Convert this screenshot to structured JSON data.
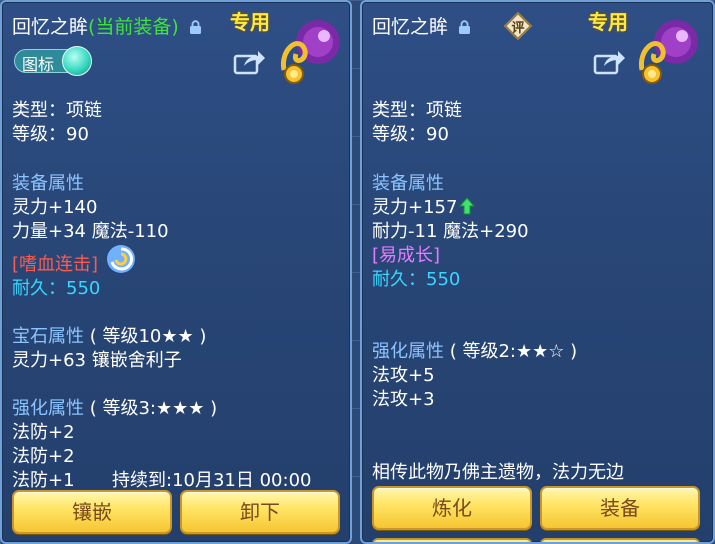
{
  "left": {
    "title": "回忆之眸",
    "title_tag": "(当前装备)",
    "exclusive": "专用",
    "toggle_label": "图标",
    "type": "类型：项链",
    "level": "等级：90",
    "equip_attr_header": "装备属性",
    "attr_lines": [
      "灵力+140",
      "力量+34 魔法-110"
    ],
    "special_skill": "[嗜血连击]",
    "durability": "耐久：550",
    "gem_header": "宝石属性",
    "gem_level": "( 等级10★★ )",
    "gem_line": "灵力+63 镶嵌舍利子",
    "enhance_header": "强化属性",
    "enhance_level": "( 等级3:★★★ )",
    "enhance_lines": [
      "法防+2",
      "法防+2",
      "法防+1"
    ],
    "duration": "持续到:10月31日 00:00",
    "buttons": [
      "镶嵌",
      "卸下"
    ]
  },
  "right": {
    "title": "回忆之眸",
    "rating": "评",
    "exclusive": "专用",
    "type": "类型：项链",
    "level": "等级：90",
    "equip_attr_header": "装备属性",
    "attr_lines": [
      "灵力+157",
      "耐力-11 魔法+290"
    ],
    "growth_tag": "[易成长]",
    "durability": "耐久：550",
    "enhance_header": "强化属性",
    "enhance_level": "( 等级2:★★☆ )",
    "enhance_lines": [
      "法攻+5",
      "法攻+3"
    ],
    "description": "相传此物乃佛主遗物，法力无边",
    "buttons": [
      "炼化",
      "装备"
    ]
  },
  "colors": {
    "panel_bg": "#2a4a7e",
    "section_blue": "#8cc4ff",
    "current_green": "#3ee33b",
    "durability_cyan": "#39d6ff",
    "skill_red": "#ff5a4c",
    "growth_pink": "#e47cff",
    "exclusive_yellow": "#ffea3b",
    "button_gold": "#ffe566"
  },
  "icons": [
    "lock-icon",
    "toggle-switch",
    "share-icon",
    "necklace-emblem",
    "rating-badge",
    "green-up-arrow-icon",
    "swirl-skill-icon"
  ]
}
